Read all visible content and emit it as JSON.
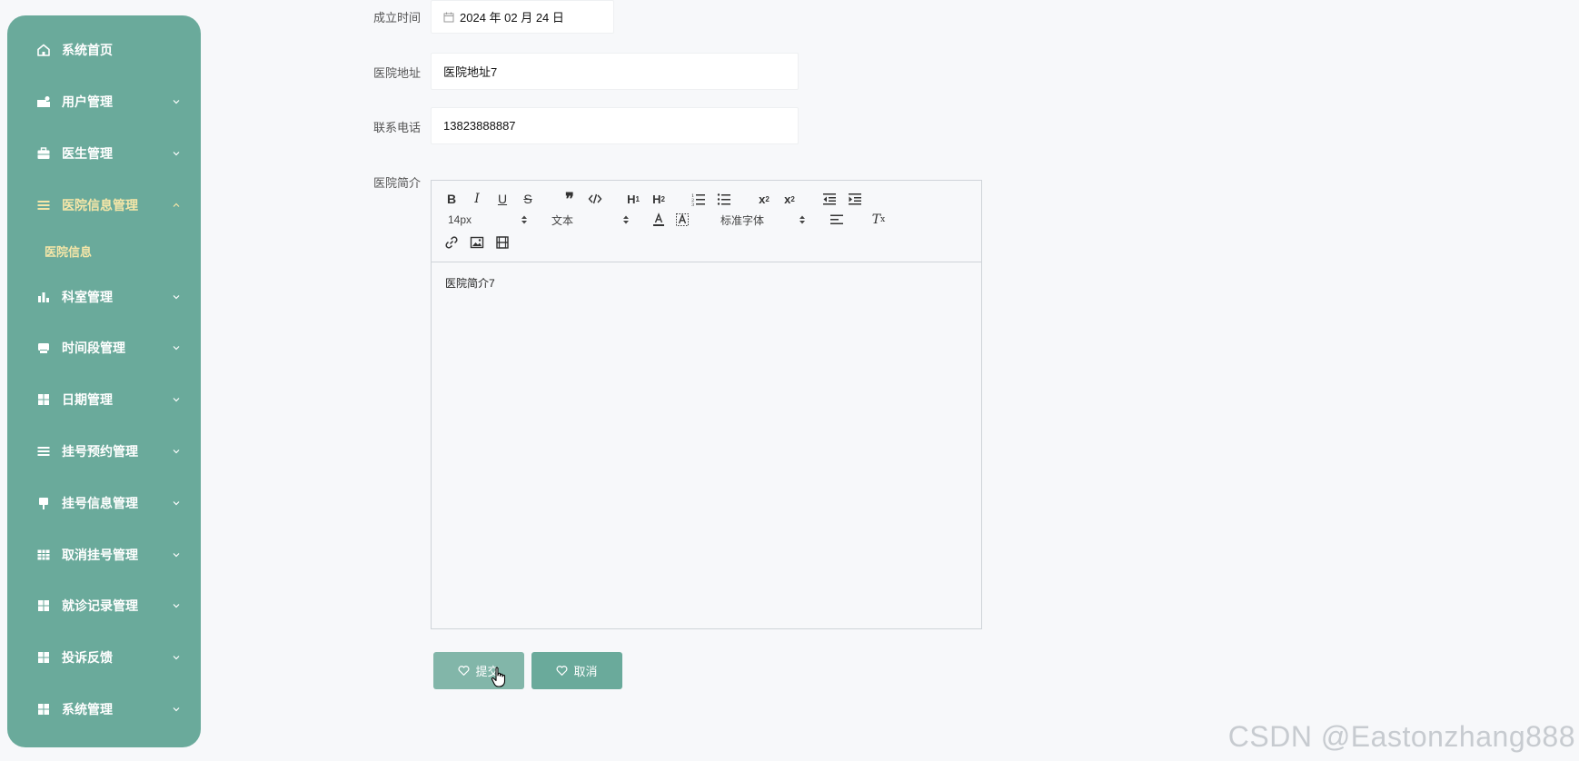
{
  "sidebar": {
    "items": [
      {
        "label": "系统首页",
        "icon": "home-icon",
        "has_chevron": false
      },
      {
        "label": "用户管理",
        "icon": "user-manage-icon",
        "has_chevron": true
      },
      {
        "label": "医生管理",
        "icon": "briefcase-icon",
        "has_chevron": true
      },
      {
        "label": "医院信息管理",
        "icon": "list-icon",
        "has_chevron": true,
        "expanded": true,
        "active": true
      },
      {
        "label": "科室管理",
        "icon": "bar-chart-icon",
        "has_chevron": true
      },
      {
        "label": "时间段管理",
        "icon": "printer-icon",
        "has_chevron": true
      },
      {
        "label": "日期管理",
        "icon": "grid-icon",
        "has_chevron": true
      },
      {
        "label": "挂号预约管理",
        "icon": "list-icon",
        "has_chevron": true
      },
      {
        "label": "挂号信息管理",
        "icon": "pin-icon",
        "has_chevron": true
      },
      {
        "label": "取消挂号管理",
        "icon": "table-icon",
        "has_chevron": true
      },
      {
        "label": "就诊记录管理",
        "icon": "grid-icon",
        "has_chevron": true
      },
      {
        "label": "投诉反馈",
        "icon": "grid-icon",
        "has_chevron": true
      },
      {
        "label": "系统管理",
        "icon": "grid-icon",
        "has_chevron": true
      }
    ],
    "sub_item": "医院信息"
  },
  "form": {
    "founded": {
      "label": "成立时间",
      "value": "2024 年 02 月 24 日"
    },
    "address": {
      "label": "医院地址",
      "value": "医院地址7"
    },
    "phone": {
      "label": "联系电话",
      "value": "13823888887"
    },
    "intro": {
      "label": "医院简介",
      "content": "医院简介7"
    }
  },
  "editor": {
    "font_size": "14px",
    "heading_select": "文本",
    "font_family": "标准字体"
  },
  "buttons": {
    "submit": "提交",
    "cancel": "取消"
  },
  "watermark": "CSDN @Eastonzhang888",
  "colors": {
    "sidebar": "#6aaa9b",
    "active_text": "#f5e6a8",
    "submit_button": "#82b6a9",
    "cancel_button": "#6aaa9b"
  }
}
